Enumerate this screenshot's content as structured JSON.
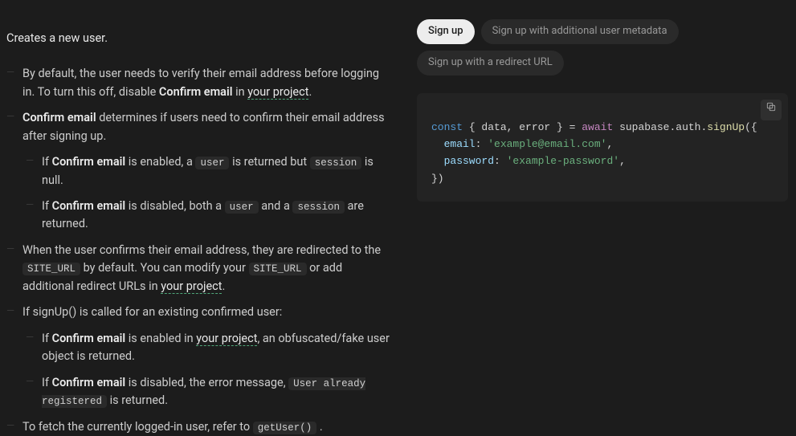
{
  "intro": "Creates a new user.",
  "bullets": {
    "b1_a": "By default, the user needs to verify their email address before logging in. To turn this off, disable ",
    "confirm_email": "Confirm email",
    "b1_b": " in ",
    "your_project": "your project",
    "b2_a": " determines if users need to confirm their email address after signing up.",
    "b2s1_a": "If ",
    "b2s1_b": " is enabled, a ",
    "user_code": "user",
    "b2s1_c": " is returned but ",
    "session_code": "session",
    "b2s1_d": " is null.",
    "b2s2_b": " is disabled, both a ",
    "b2s2_c": " and a ",
    "b2s2_d": " are returned.",
    "b3_a": "When the user confirms their email address, they are redirected to the ",
    "site_url": "SITE_URL",
    "b3_b": " by default. You can modify your ",
    "b3_c": " or add additional redirect URLs in ",
    "b4": "If signUp() is called for an existing confirmed user:",
    "b4s1_b": " is enabled in ",
    "b4s1_c": ", an obfuscated/fake user object is returned.",
    "b4s2_b": " is disabled, the error message, ",
    "user_already": "User already registered",
    "b4s2_c": " is returned.",
    "b5_a": "To fetch the currently logged-in user, refer to ",
    "getuser": "getUser()",
    "b5_b": " ."
  },
  "tabs": {
    "t1": "Sign up",
    "t2": "Sign up with additional user metadata",
    "t3": "Sign up with a redirect URL"
  },
  "code": {
    "l1_a": "const",
    "l1_b": " { data, error } = ",
    "l1_c": "await",
    "l1_d": " supabase.auth.",
    "l1_e": "signUp",
    "l1_f": "({",
    "l2_a": "  email",
    "l2_b": ": ",
    "l2_c": "'example@email.com'",
    "l2_d": ",",
    "l3_a": "  password",
    "l3_c": "'example-password'",
    "l4": "})"
  }
}
